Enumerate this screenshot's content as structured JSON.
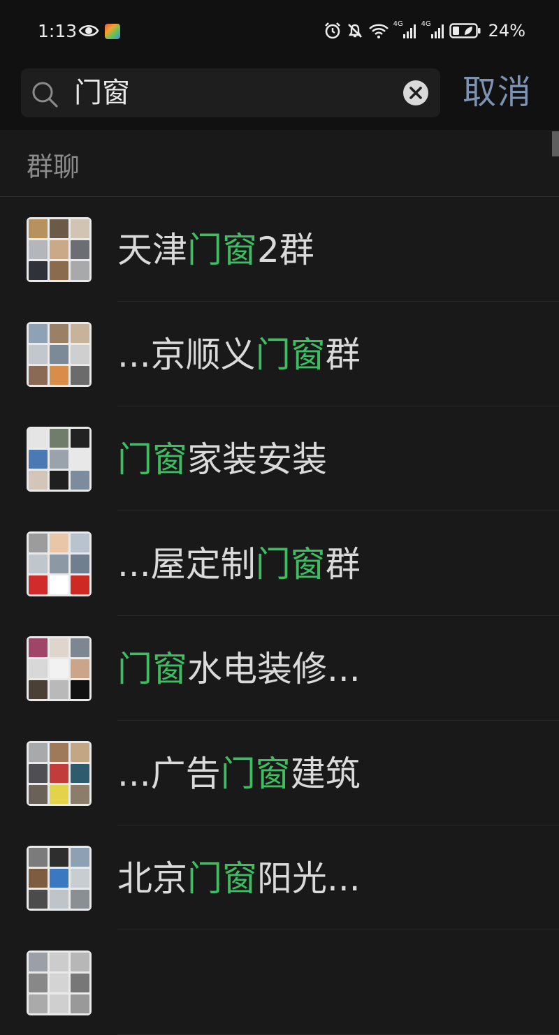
{
  "status_bar": {
    "time": "1:13",
    "battery_text": "24%",
    "network_badge_1": "4G",
    "network_badge_2": "4G"
  },
  "search": {
    "query": "门窗",
    "cancel_label": "取消"
  },
  "section": {
    "title": "群聊"
  },
  "highlight_color": "#3fbd62",
  "groups": [
    {
      "pre": "天津",
      "hl": "门窗",
      "post": "2群",
      "tiles": [
        "#b7925e",
        "#6b5a48",
        "#d0c4b2",
        "#b3b6ba",
        "#c9a987",
        "#6b6f73",
        "#2f3238",
        "#8a6b4e",
        "#a7a9ab"
      ]
    },
    {
      "pre": "...京顺义",
      "hl": "门窗",
      "post": "群",
      "tiles": [
        "#8fa2b5",
        "#9a8066",
        "#c7b39a",
        "#c1c7cc",
        "#7b8a96",
        "#cfcfcf",
        "#8a6a55",
        "#d98d4a",
        "#6b6b6b"
      ]
    },
    {
      "pre": "",
      "hl": "门窗",
      "post": "家装安装",
      "tiles": [
        "#e5e5e5",
        "#6f7d6a",
        "#222222",
        "#4a79b3",
        "#9aa3ab",
        "#e8e8e8",
        "#d3c5b8",
        "#1f1f1f",
        "#7c8c9c"
      ]
    },
    {
      "pre": "...屋定制",
      "hl": "门窗",
      "post": "群",
      "tiles": [
        "#9c9c9c",
        "#e9c6a8",
        "#b8c3cf",
        "#bfc6cc",
        "#8d98a5",
        "#6f7f8f",
        "#d12b2b",
        "#ffffff",
        "#cc2a22"
      ]
    },
    {
      "pre": "",
      "hl": "门窗",
      "post": "水电装修...",
      "tiles": [
        "#a04468",
        "#ded5cc",
        "#7e8791",
        "#d8d8d8",
        "#f2f2f2",
        "#cba58a",
        "#4a4036",
        "#b9b9b9",
        "#111111"
      ]
    },
    {
      "pre": "...广告",
      "hl": "门窗",
      "post": "建筑",
      "tiles": [
        "#a7a9ab",
        "#9e7a5b",
        "#c1a784",
        "#4f4f53",
        "#c23c3c",
        "#2f5b6e",
        "#6a6258",
        "#e2d34a",
        "#8c7c6a"
      ]
    },
    {
      "pre": "北京",
      "hl": "门窗",
      "post": "阳光...",
      "tiles": [
        "#7b7b7b",
        "#2e2e2e",
        "#8ea0b4",
        "#7e5c3f",
        "#3b78c2",
        "#c8cdd2",
        "#4b4b4b",
        "#bfc4c9",
        "#8a8f94"
      ]
    },
    {
      "pre": "",
      "hl": "",
      "post": "",
      "tiles": [
        "#9aa0a6",
        "#cccccc",
        "#b7b7b7",
        "#888888",
        "#d4d4d4",
        "#777777",
        "#aaaaaa",
        "#cfcfcf",
        "#999999"
      ]
    }
  ]
}
